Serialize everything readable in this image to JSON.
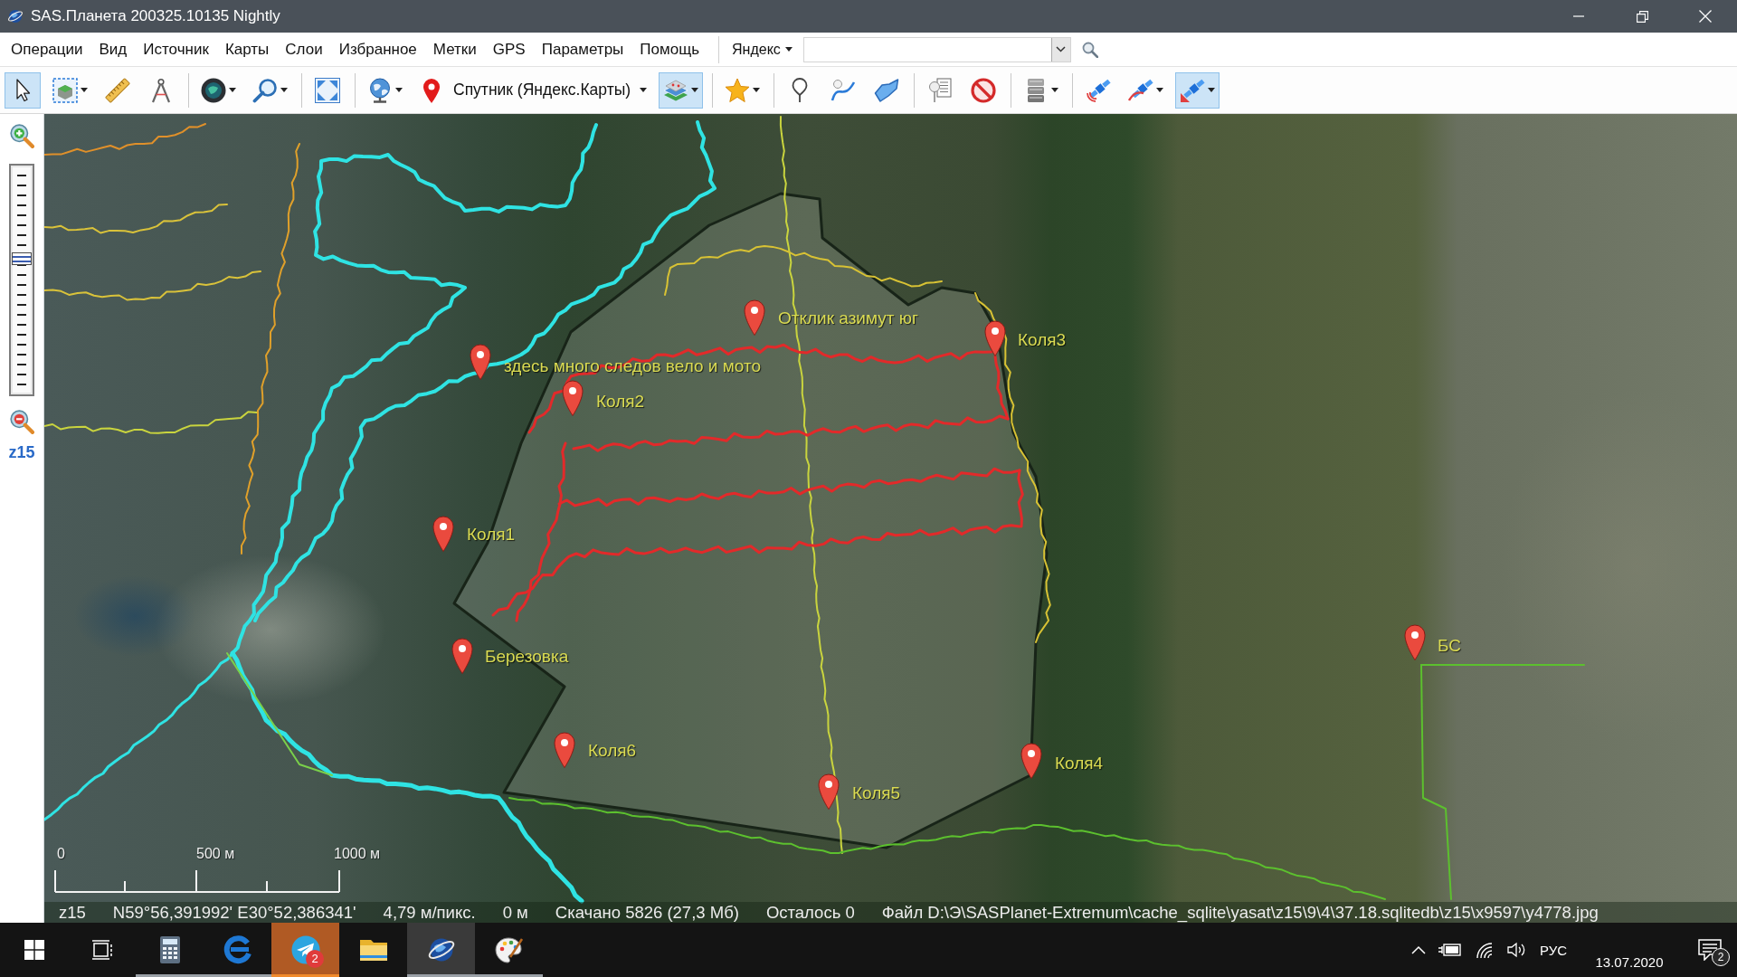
{
  "window": {
    "title": "SAS.Планета 200325.10135 Nightly"
  },
  "menu": [
    "Операции",
    "Вид",
    "Источник",
    "Карты",
    "Слои",
    "Избранное",
    "Метки",
    "GPS",
    "Параметры",
    "Помощь"
  ],
  "search": {
    "engine": "Яндекс"
  },
  "toolbar": {
    "groups": [
      [
        {
          "pressed": true,
          "dropdown": false
        },
        {
          "pressed": false,
          "dropdown": true
        },
        {
          "pressed": false,
          "dropdown": false
        },
        {
          "pressed": false,
          "dropdown": false
        }
      ],
      [
        {
          "pressed": false,
          "dropdown": true
        },
        {
          "pressed": false,
          "dropdown": true
        }
      ],
      [
        {
          "pressed": false,
          "dropdown": false
        }
      ],
      [
        {
          "pressed": false,
          "dropdown": true
        },
        {
          "pressed": false,
          "dropdown": true,
          "label": "Спутник (Яндекс.Карты)"
        },
        {
          "pressed": true,
          "dropdown": true
        }
      ],
      [
        {
          "pressed": false,
          "dropdown": true
        }
      ],
      [
        {
          "pressed": false,
          "dropdown": false
        },
        {
          "pressed": false,
          "dropdown": false
        },
        {
          "pressed": false,
          "dropdown": false
        }
      ],
      [
        {
          "pressed": false,
          "dropdown": false
        },
        {
          "pressed": false,
          "dropdown": false
        }
      ],
      [
        {
          "pressed": false,
          "dropdown": true
        }
      ],
      [
        {
          "pressed": false,
          "dropdown": false
        },
        {
          "pressed": false,
          "dropdown": true
        },
        {
          "pressed": true,
          "dropdown": true
        }
      ]
    ]
  },
  "zoom_control": {
    "level": 0.6,
    "label": "z15"
  },
  "map": {
    "placemarks": [
      {
        "label": "Отклик азимут юг"
      },
      {
        "label": "Коля3"
      },
      {
        "label": "здесь много следов вело и мото"
      },
      {
        "label": "Коля2"
      },
      {
        "label": "Коля1"
      },
      {
        "label": "БС"
      },
      {
        "label": "Березовка"
      },
      {
        "label": "Коля4"
      },
      {
        "label": "Коля6"
      },
      {
        "label": "Коля5"
      }
    ],
    "scale": [
      "0",
      "500 м",
      "1000 м"
    ]
  },
  "status_bar": {
    "zoom": "z15",
    "coordinates": "N59°56,391992' E30°52,386341'",
    "resolution": "4,79 м/пикс.",
    "distance": "0 м",
    "downloaded": "Скачано 5826 (27,3 Мб)",
    "remaining": "Осталось 0",
    "file": "Файл D:\\Э\\SASPlanet-Extremum\\cache_sqlite\\yasat\\z15\\9\\4\\37.18.sqlitedb\\z15\\x9597\\y4778.jpg"
  },
  "taskbar": {
    "apps": [
      {
        "running": true,
        "active": false,
        "attention": false
      },
      {
        "running": true,
        "active": false,
        "attention": false
      },
      {
        "running": true,
        "active": false,
        "attention": true,
        "badge": "2"
      },
      {
        "running": false,
        "active": false,
        "attention": false
      },
      {
        "running": true,
        "active": true,
        "attention": false
      },
      {
        "running": true,
        "active": false,
        "attention": false
      }
    ],
    "tray": {
      "language": "РУС",
      "date": "13.07.2020",
      "notifications": "2"
    }
  }
}
